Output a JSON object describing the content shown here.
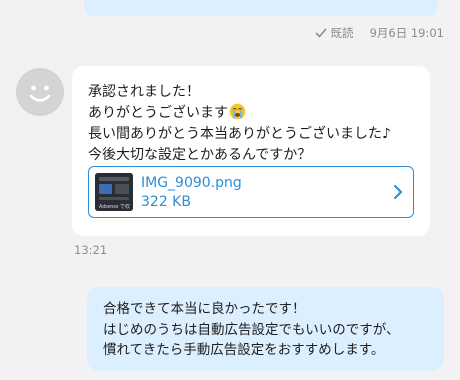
{
  "previous_message": {
    "read_status": "既読",
    "timestamp": "9月6日 19:01"
  },
  "received_message": {
    "lines": [
      "承認されました！",
      "ありがとうございます",
      "長い間ありがとう本当ありがとうございました♪",
      "今後大切な設定とかあるんですか？"
    ],
    "emoji": "crying-face",
    "attachment": {
      "file_name": "IMG_9090.png",
      "file_size": "322 KB",
      "thumbnail_caption": "Adsense で収"
    },
    "timestamp": "13:21"
  },
  "sent_message": {
    "lines": [
      "合格できて本当に良かったです！",
      "はじめのうちは自動広告設定でもいいのですが、",
      "慣れてきたら手動広告設定をおすすめします。"
    ]
  },
  "colors": {
    "background": "#f2f2f4",
    "sent_bubble": "#dcefff",
    "received_bubble": "#ffffff",
    "link_accent": "#2b8fd6",
    "meta_text": "#8c8c8c"
  }
}
